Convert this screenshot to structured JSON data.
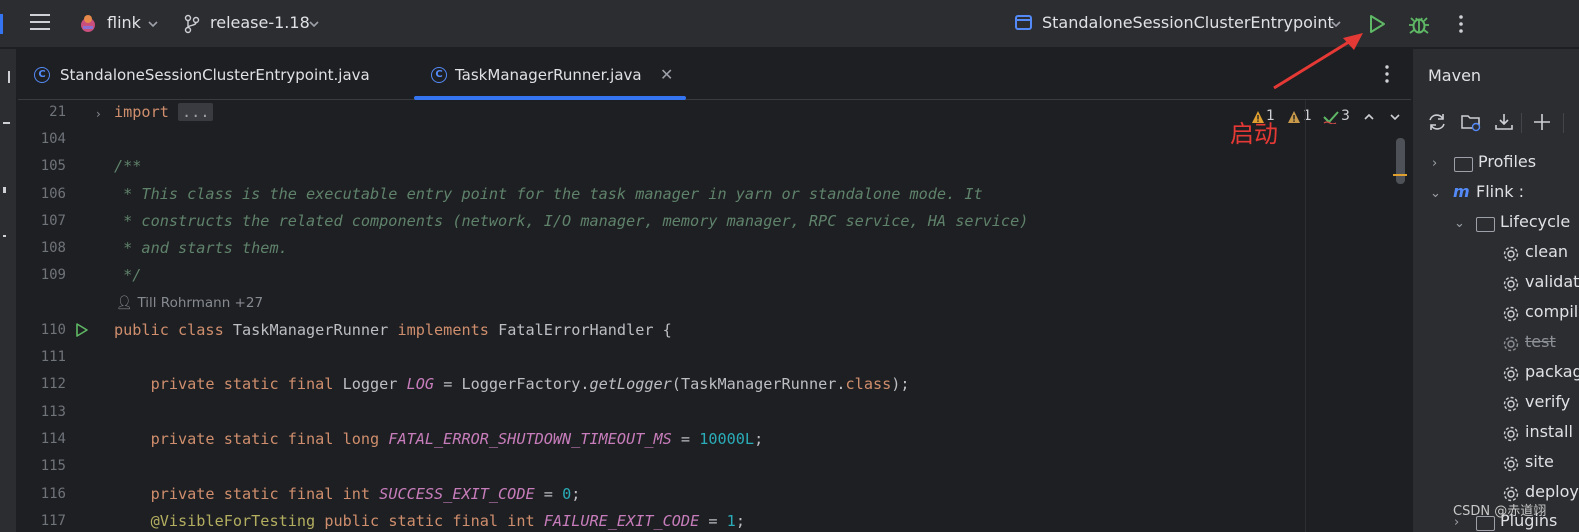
{
  "titlebar": {
    "project": "flink",
    "branch": "release-1.18",
    "run_config": "StandaloneSessionClusterEntrypoint"
  },
  "tabs": [
    {
      "label": "StandaloneSessionClusterEntrypoint.java",
      "active": false
    },
    {
      "label": "TaskManagerRunner.java",
      "active": true
    }
  ],
  "editor": {
    "line_numbers": [
      "21",
      "104",
      "105",
      "106",
      "107",
      "108",
      "109",
      "110",
      "111",
      "112",
      "113",
      "114",
      "115",
      "116",
      "117"
    ],
    "author_hint": "Till Rohrmann +27",
    "import_kw": "import",
    "import_fold": "...",
    "inspections": {
      "warnings_a": "1",
      "warnings_b": "1",
      "ok": "3"
    },
    "annotation": "启动",
    "code": {
      "l105": "/**",
      "l106": " * This class is the executable entry point for the task manager in yarn or standalone mode. It",
      "l107": " * constructs the related components (network, I/O manager, memory manager, RPC service, HA service)",
      "l108": " * and starts them.",
      "l109": " */",
      "l110_kw": "public class ",
      "l110_name": "TaskManagerRunner ",
      "l110_impl": "implements ",
      "l110_rest": "FatalErrorHandler {",
      "l112_kw": "    private static final ",
      "l112_type": "Logger ",
      "l112_field": "LOG",
      "l112_mid": " = LoggerFactory.",
      "l112_call": "getLogger",
      "l112_arg": "(TaskManagerRunner.",
      "l112_cls": "class",
      "l112_end": ");",
      "l114_kw": "    private static final long ",
      "l114_field": "FATAL_ERROR_SHUTDOWN_TIMEOUT_MS",
      "l114_eq": " = ",
      "l114_val": "10000L",
      "l114_end": ";",
      "l116_kw": "    private static final int ",
      "l116_field": "SUCCESS_EXIT_CODE",
      "l116_eq": " = ",
      "l116_val": "0",
      "l116_end": ";",
      "l117_anno": "    @VisibleForTesting ",
      "l117_kw": "public static final int ",
      "l117_field": "FAILURE_EXIT_CODE",
      "l117_eq": " = ",
      "l117_val": "1",
      "l117_end": ";"
    }
  },
  "maven": {
    "title": "Maven",
    "tree": [
      {
        "label": "Profiles",
        "strike": false
      },
      {
        "label": "Flink :",
        "strike": false
      },
      {
        "label": "Lifecycle",
        "strike": false
      },
      {
        "label": "clean",
        "strike": false
      },
      {
        "label": "validate",
        "strike": false
      },
      {
        "label": "compile",
        "strike": false
      },
      {
        "label": "test",
        "strike": true
      },
      {
        "label": "package",
        "strike": false
      },
      {
        "label": "verify",
        "strike": false
      },
      {
        "label": "install",
        "strike": false
      },
      {
        "label": "site",
        "strike": false
      },
      {
        "label": "deploy",
        "strike": false
      },
      {
        "label": "Plugins",
        "strike": false
      }
    ]
  },
  "watermark": "CSDN @赤道翊",
  "colors": {
    "accent": "#3574f0",
    "run_green": "#5fb865",
    "annotation_red": "#e53935"
  }
}
